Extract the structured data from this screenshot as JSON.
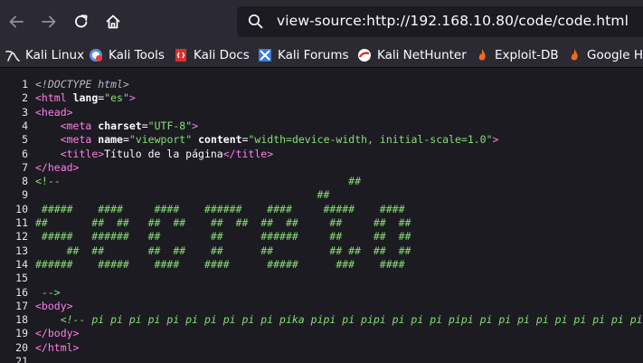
{
  "toolbar": {
    "url": "view-source:http://192.168.10.80/code/code.html",
    "back_icon": "arrow-left-icon",
    "forward_icon": "arrow-right-icon",
    "reload_icon": "reload-icon",
    "home_icon": "home-icon",
    "search_icon": "search-icon"
  },
  "bookmarks": [
    {
      "label": "Kali Linux",
      "icon": "kali-dragon-icon"
    },
    {
      "label": "Kali Tools",
      "icon": "kali-tools-icon"
    },
    {
      "label": "Kali Docs",
      "icon": "kali-docs-icon"
    },
    {
      "label": "Kali Forums",
      "icon": "kali-forums-icon"
    },
    {
      "label": "Kali NetHunter",
      "icon": "kali-nethunter-icon"
    },
    {
      "label": "Exploit-DB",
      "icon": "exploit-db-icon"
    },
    {
      "label": "Google Ha",
      "icon": "google-hacking-icon"
    }
  ],
  "source": {
    "lines": [
      {
        "n": "1",
        "segs": [
          [
            "doctype",
            "<!DOCTYPE html>"
          ]
        ]
      },
      {
        "n": "2",
        "segs": [
          [
            "tag",
            "<html"
          ],
          [
            "plain",
            " "
          ],
          [
            "attr",
            "lang"
          ],
          [
            "plain",
            "="
          ],
          [
            "val",
            "\"es\""
          ],
          [
            "tag",
            ">"
          ]
        ]
      },
      {
        "n": "3",
        "segs": [
          [
            "tag",
            "<head>"
          ]
        ]
      },
      {
        "n": "4",
        "segs": [
          [
            "plain",
            "    "
          ],
          [
            "tag",
            "<meta"
          ],
          [
            "plain",
            " "
          ],
          [
            "attr",
            "charset"
          ],
          [
            "plain",
            "="
          ],
          [
            "val",
            "\"UTF-8\""
          ],
          [
            "tag",
            ">"
          ]
        ]
      },
      {
        "n": "5",
        "segs": [
          [
            "plain",
            "    "
          ],
          [
            "tag",
            "<meta"
          ],
          [
            "plain",
            " "
          ],
          [
            "attr",
            "name"
          ],
          [
            "plain",
            "="
          ],
          [
            "val",
            "\"viewport\""
          ],
          [
            "plain",
            " "
          ],
          [
            "attr",
            "content"
          ],
          [
            "plain",
            "="
          ],
          [
            "val",
            "\"width=device-width, initial-scale=1.0\""
          ],
          [
            "tag",
            ">"
          ]
        ]
      },
      {
        "n": "6",
        "segs": [
          [
            "plain",
            "    "
          ],
          [
            "tag",
            "<title>"
          ],
          [
            "plain",
            "Título de la página"
          ],
          [
            "tag",
            "</title>"
          ]
        ]
      },
      {
        "n": "7",
        "segs": [
          [
            "tag",
            "</head>"
          ]
        ]
      },
      {
        "n": "8",
        "segs": [
          [
            "comment",
            "<!--                                              ##"
          ]
        ]
      },
      {
        "n": "9",
        "segs": [
          [
            "comment",
            "                                             ##"
          ]
        ]
      },
      {
        "n": "10",
        "segs": [
          [
            "comment",
            " #####    ####     ####    ######    ####     #####    ####"
          ]
        ]
      },
      {
        "n": "11",
        "segs": [
          [
            "comment",
            "##       ##  ##   ##  ##    ##  ##  ##  ##     ##     ##  ##"
          ]
        ]
      },
      {
        "n": "12",
        "segs": [
          [
            "comment",
            " #####   ######   ##        ##      ######     ##     ##  ##"
          ]
        ]
      },
      {
        "n": "13",
        "segs": [
          [
            "comment",
            "     ##  ##       ##  ##    ##      ##         ## ##  ##  ##"
          ]
        ]
      },
      {
        "n": "14",
        "segs": [
          [
            "comment",
            "######    #####    ####    ####      #####      ###    ####"
          ]
        ]
      },
      {
        "n": "15",
        "segs": []
      },
      {
        "n": "16",
        "segs": [
          [
            "comment",
            " -->"
          ]
        ]
      },
      {
        "n": "17",
        "segs": [
          [
            "tag",
            "<body>"
          ]
        ]
      },
      {
        "n": "18",
        "segs": [
          [
            "plain",
            "    "
          ],
          [
            "comment it",
            "<!-- pi pi pi pi pi pi pi pi pi pi pika pipi pi pipi pi pi pi pipi pi pi pi pi pi pi pi pi pi pi pi pi"
          ]
        ]
      },
      {
        "n": "19",
        "segs": [
          [
            "tag",
            "</body>"
          ]
        ]
      },
      {
        "n": "20",
        "segs": [
          [
            "tag",
            "</html>"
          ]
        ]
      },
      {
        "n": "21",
        "segs": []
      }
    ]
  }
}
